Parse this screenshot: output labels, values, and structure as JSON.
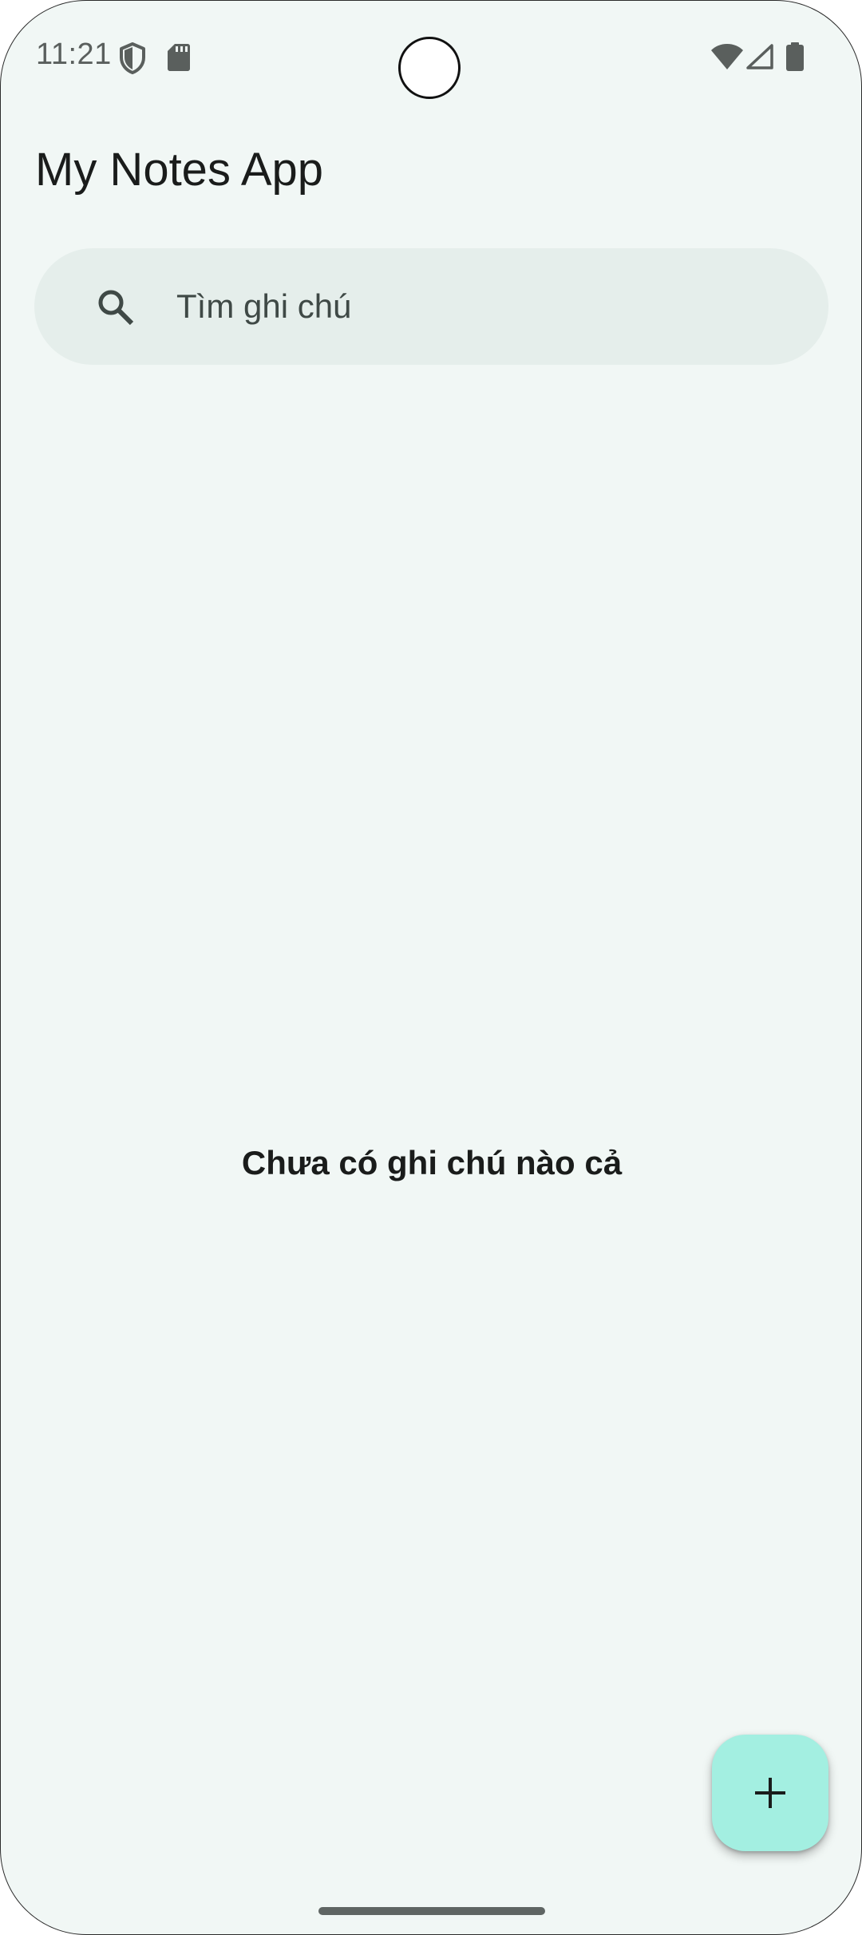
{
  "status_bar": {
    "time": "11:21",
    "left_icons": [
      "shield-icon",
      "sd-card-icon"
    ],
    "right_icons": [
      "wifi-icon",
      "signal-icon",
      "battery-icon"
    ]
  },
  "app": {
    "title": "My Notes App"
  },
  "search": {
    "placeholder": "Tìm ghi chú",
    "value": "",
    "icon": "search-icon"
  },
  "empty_state": {
    "message": "Chưa có ghi chú nào cả"
  },
  "fab": {
    "icon": "plus-icon",
    "color": "#a3efe1"
  },
  "colors": {
    "background": "#f1f7f5",
    "search_background": "#e5eeeb",
    "text_primary": "#1a1c1b"
  }
}
